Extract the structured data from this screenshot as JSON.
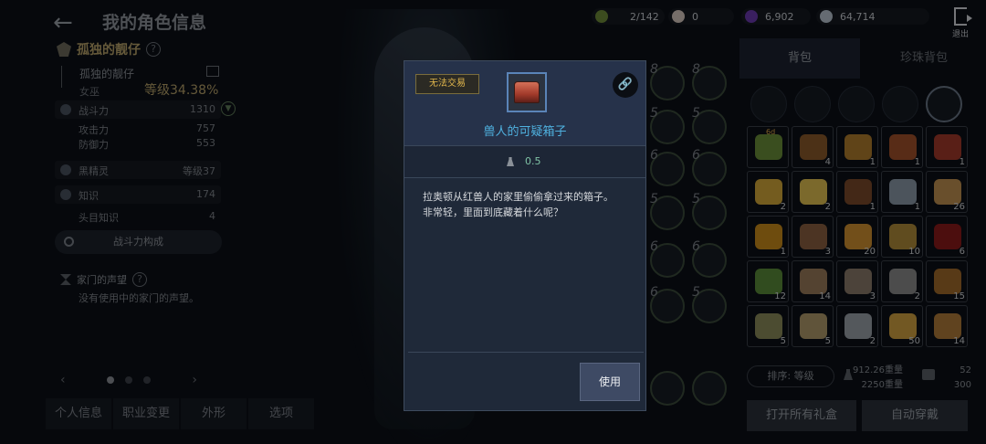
{
  "header": {
    "title": "我的角色信息",
    "back_label": "←"
  },
  "character": {
    "title_name": "孤独的靓仔",
    "name": "孤独的靓仔",
    "class": "女巫",
    "level_label": "等级34.38%",
    "stats": [
      {
        "label": "战斗力",
        "value": "1310"
      },
      {
        "label": "攻击力",
        "value": "757"
      },
      {
        "label": "防御力",
        "value": "553"
      },
      {
        "label": "黑精灵",
        "value": "等级37"
      },
      {
        "label": "知识",
        "value": "174"
      },
      {
        "label": "头目知识",
        "value": "4"
      }
    ],
    "combat_button": "战斗力构成",
    "family_title": "家门的声望",
    "family_desc": "没有使用中的家门的声望。"
  },
  "bottom_tabs": [
    "个人信息",
    "职业变更",
    "外形",
    "选项"
  ],
  "pager": {
    "prev": "‹",
    "next": "›"
  },
  "currency": {
    "slots": "2/142",
    "pearl": "0",
    "purple": "6,902",
    "silver": "64,714"
  },
  "exit_label": "退出",
  "skill_slot_numbers": [
    "8",
    "8",
    "5",
    "5",
    "6",
    "6",
    "5",
    "5",
    "6",
    "6",
    "6",
    "5"
  ],
  "inventory": {
    "tabs": [
      "背包",
      "珍珠背包"
    ],
    "filter_icons": [
      "weapon-filter-icon",
      "armor-filter-icon",
      "accessory-filter-icon",
      "gem-filter-icon",
      "potion-filter-icon"
    ],
    "items": [
      {
        "q": "",
        "color": "#6b8e3a",
        "badge": "6d"
      },
      {
        "q": "4",
        "color": "#8a5a2a"
      },
      {
        "q": "1",
        "color": "#b07c2c"
      },
      {
        "q": "1",
        "color": "#a0502a"
      },
      {
        "q": "1",
        "color": "#a23a2a"
      },
      {
        "q": "2",
        "color": "#d4a83a"
      },
      {
        "q": "2",
        "color": "#e0c050"
      },
      {
        "q": "1",
        "color": "#7a4a2a"
      },
      {
        "q": "1",
        "color": "#8a9aa8"
      },
      {
        "q": "26",
        "color": "#c09050"
      },
      {
        "q": "1",
        "color": "#c88a1a"
      },
      {
        "q": "3",
        "color": "#8a6040"
      },
      {
        "q": "20",
        "color": "#d09030"
      },
      {
        "q": "10",
        "color": "#b08a3a"
      },
      {
        "q": "6",
        "color": "#8a1a1a"
      },
      {
        "q": "12",
        "color": "#5a8a3a"
      },
      {
        "q": "14",
        "color": "#9a7a5a"
      },
      {
        "q": "3",
        "color": "#8a7a6a"
      },
      {
        "q": "2",
        "color": "#8a8a8a"
      },
      {
        "q": "15",
        "color": "#a06a2a"
      },
      {
        "q": "5",
        "color": "#8a8a5a"
      },
      {
        "q": "5",
        "color": "#b09a6a"
      },
      {
        "q": "2",
        "color": "#9aa0a8"
      },
      {
        "q": "50",
        "color": "#d0a040"
      },
      {
        "q": "14",
        "color": "#b07a3a"
      }
    ],
    "sort_label": "排序: 等级",
    "weight_current": "912.26重量",
    "weight_max": "2250重量",
    "slots_used": "52",
    "slots_total": "300",
    "open_gifts": "打开所有礼盒",
    "auto_equip": "自动穿戴"
  },
  "modal": {
    "tradeable": "无法交易",
    "item_name": "兽人的可疑箱子",
    "weight": "0.5",
    "desc_line1": "拉奥顿从红兽人的家里偷偷拿过来的箱子。",
    "desc_line2": "非常轻，里面到底藏着什么呢？",
    "use_label": "使用"
  }
}
